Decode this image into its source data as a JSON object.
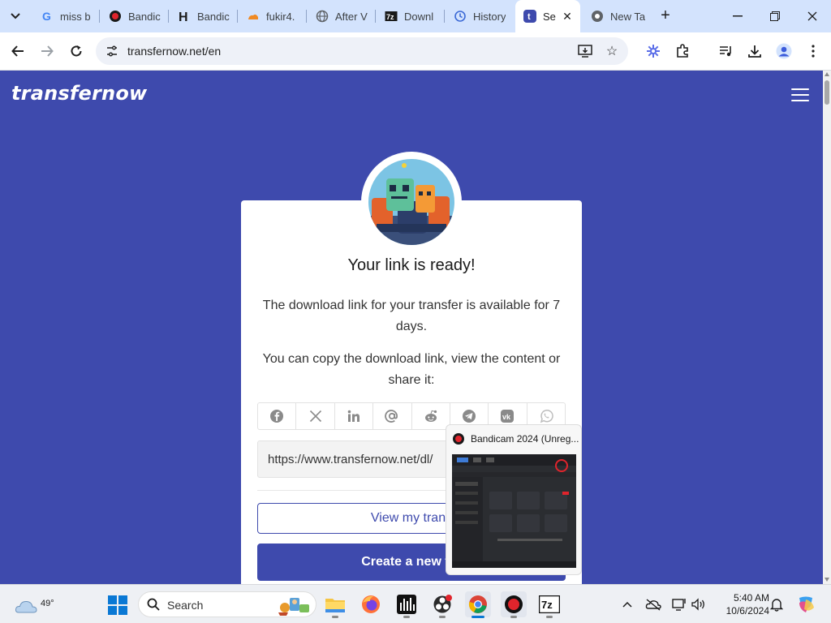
{
  "browser": {
    "tabs": [
      {
        "label": "miss b",
        "active": false
      },
      {
        "label": "Bandic",
        "active": false
      },
      {
        "label": "Bandic",
        "active": false
      },
      {
        "label": "fukir4.",
        "active": false
      },
      {
        "label": "After V",
        "active": false
      },
      {
        "label": "Downl",
        "active": false
      },
      {
        "label": "History",
        "active": false
      },
      {
        "label": "Se",
        "active": true
      },
      {
        "label": "New Ta",
        "active": false
      }
    ],
    "url": "transfernow.net/en"
  },
  "page": {
    "logo": "transfernow",
    "card": {
      "title": "Your link is ready!",
      "text1": "The download link for your transfer is available for 7 days.",
      "text2": "You can copy the download link, view the content or share it:",
      "share_icons": [
        "facebook-icon",
        "x-icon",
        "linkedin-icon",
        "email-icon",
        "reddit-icon",
        "telegram-icon",
        "vk-icon",
        "whatsapp-icon"
      ],
      "link_value": "https://www.transfernow.net/dl/",
      "view_button": "View my trans",
      "create_button": "Create a new tra"
    }
  },
  "preview": {
    "title": "Bandicam 2024 (Unreg..."
  },
  "taskbar": {
    "temperature": "49°",
    "search_label": "Search",
    "time": "5:40 AM",
    "date": "10/6/2024"
  },
  "colors": {
    "brand": "#3e4aad",
    "tabstrip": "#d3e3fd",
    "windows_blue": "#0a78d4"
  }
}
